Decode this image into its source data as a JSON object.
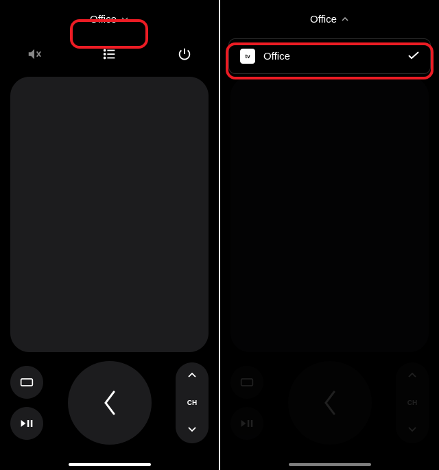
{
  "left": {
    "device_name": "Office",
    "channel_label": "CH"
  },
  "right": {
    "device_name": "Office",
    "channel_label": "CH",
    "dropdown": {
      "items": [
        {
          "icon_label": "tv",
          "label": "Office",
          "selected": true
        }
      ]
    }
  }
}
